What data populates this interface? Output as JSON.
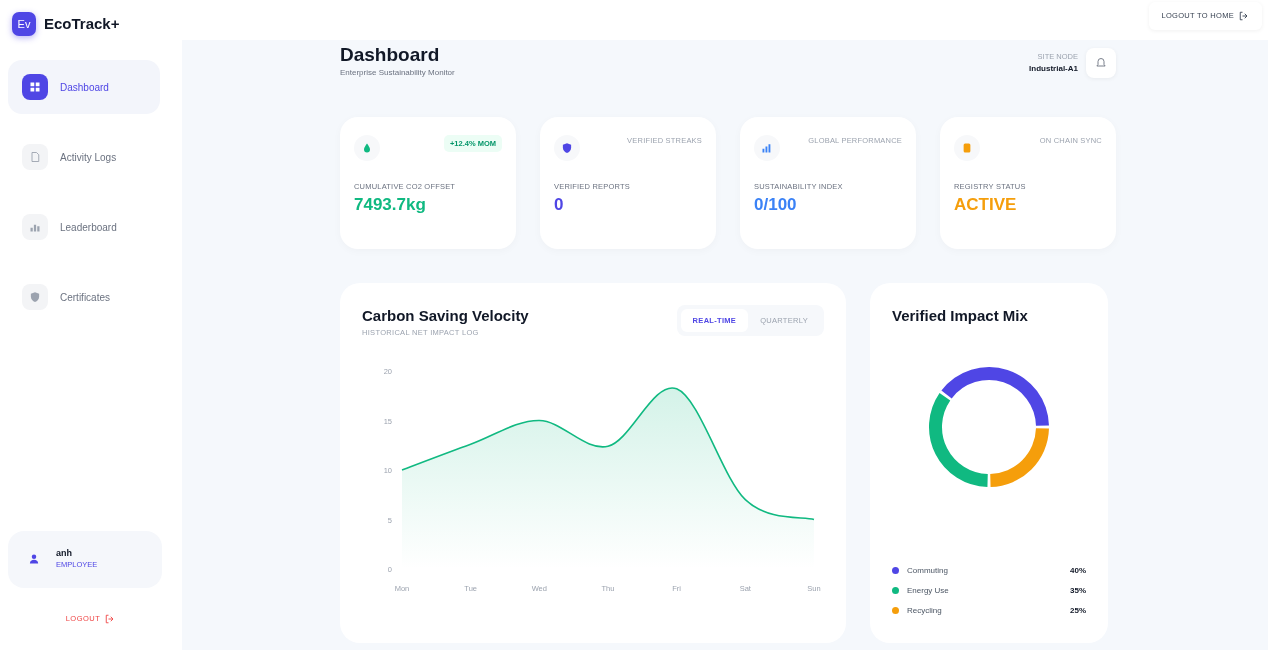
{
  "brand": {
    "logo": "Ev",
    "name": "EcoTrack+"
  },
  "sidebar": {
    "items": [
      {
        "label": "Dashboard",
        "selected": true
      },
      {
        "label": "Activity Logs",
        "selected": false
      },
      {
        "label": "Leaderboard",
        "selected": false
      },
      {
        "label": "Certificates",
        "selected": false
      }
    ],
    "user": {
      "name": "anh",
      "role": "EMPLOYEE"
    },
    "logout": "LOGOUT"
  },
  "top_link": "LOGOUT TO HOME",
  "header": {
    "title": "Dashboard",
    "subtitle": "Enterprise Sustainability Monitor",
    "site_label": "SITE NODE",
    "site_value": "Industrial-A1"
  },
  "stats": [
    {
      "color": "#10b981",
      "badge": "+12.4% MOM",
      "label": "CUMULATIVE CO2 OFFSET",
      "value": "7493.7kg"
    },
    {
      "color": "#4f46e5",
      "tag": "VERIFIED STREAKS",
      "label": "VERIFIED REPORTS",
      "value": "0"
    },
    {
      "color": "#3b82f6",
      "tag": "GLOBAL PERFORMANCE",
      "label": "SUSTAINABILITY INDEX",
      "value": "0/100"
    },
    {
      "color": "#f59e0b",
      "tag": "ON CHAIN SYNC",
      "label": "REGISTRY STATUS",
      "value": "ACTIVE"
    }
  ],
  "velocity": {
    "title": "Carbon Saving Velocity",
    "subtitle": "HISTORICAL NET IMPACT LOG",
    "toggles": [
      {
        "label": "REAL-TIME",
        "selected": true
      },
      {
        "label": "QUARTERLY",
        "selected": false
      }
    ],
    "chart_data": {
      "type": "area",
      "categories": [
        "Mon",
        "Tue",
        "Wed",
        "Thu",
        "Fri",
        "Sat",
        "Sun"
      ],
      "series": [
        {
          "color": "#10b981",
          "values": [
            10,
            12.6,
            15,
            12.4,
            18.2,
            7,
            5
          ]
        }
      ],
      "ylim": [
        0,
        20
      ],
      "yticks": [
        0,
        5,
        10,
        15,
        20
      ]
    }
  },
  "impact": {
    "title": "Verified Impact Mix",
    "chart_data": {
      "type": "donut",
      "categories": [
        "Commuting",
        "Energy Use",
        "Recycling"
      ],
      "series": [
        {
          "values": [
            40,
            35,
            25
          ]
        }
      ]
    },
    "legend": [
      {
        "value": "40%",
        "color": "#4f46e5"
      },
      {
        "value": "35%",
        "color": "#10b981"
      },
      {
        "value": "25%",
        "color": "#f59e0b"
      }
    ]
  }
}
